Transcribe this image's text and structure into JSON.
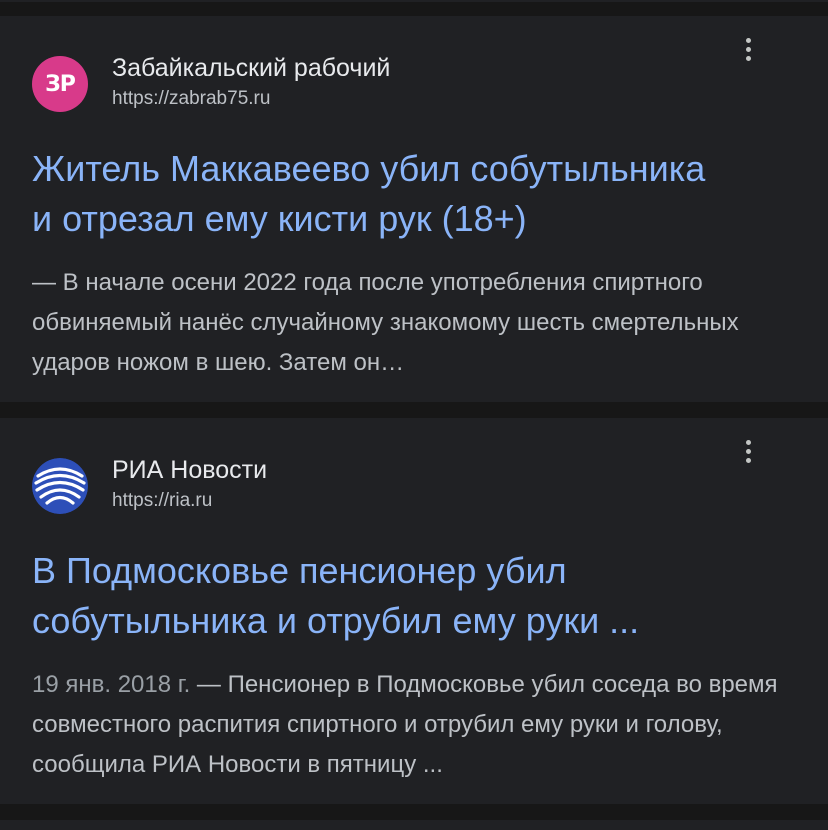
{
  "results": [
    {
      "source_name": "Забайкальский рабочий",
      "source_url": "https://zabrab75.ru",
      "favicon_text": "ЗР",
      "favicon_icon": "zabrab-logo-icon",
      "title_line1": "Житель Маккавеево убил собутыльника",
      "title_line2": "и отрезал ему кисти рук (18+)",
      "date": "",
      "snippet": "— В начале осени 2022 года после употребления спиртного обвиняемый нанёс случайному знакомому шесть смертельных ударов ножом в шею. Затем он…"
    },
    {
      "source_name": "РИА Новости",
      "source_url": "https://ria.ru",
      "favicon_icon": "ria-logo-icon",
      "title_line1": "В Подмосковье пенсионер убил",
      "title_line2": "собутыльника и отрубил ему руки ...",
      "date": "19 янв. 2018 г.",
      "snippet": " — Пенсионер в Подмосковье убил соседа во время совместного распития спиртного и отрубил ему руки и голову, сообщила РИА Новости в пятницу ..."
    }
  ],
  "colors": {
    "page_bg": "#171717",
    "card_bg": "#202124",
    "title_link": "#8ab4f8",
    "source_text": "#e8eaed",
    "snippet_text": "#bdc1c6",
    "zr_favicon_bg": "#d83a8a",
    "ria_favicon_bg": "#2d4fb8"
  }
}
